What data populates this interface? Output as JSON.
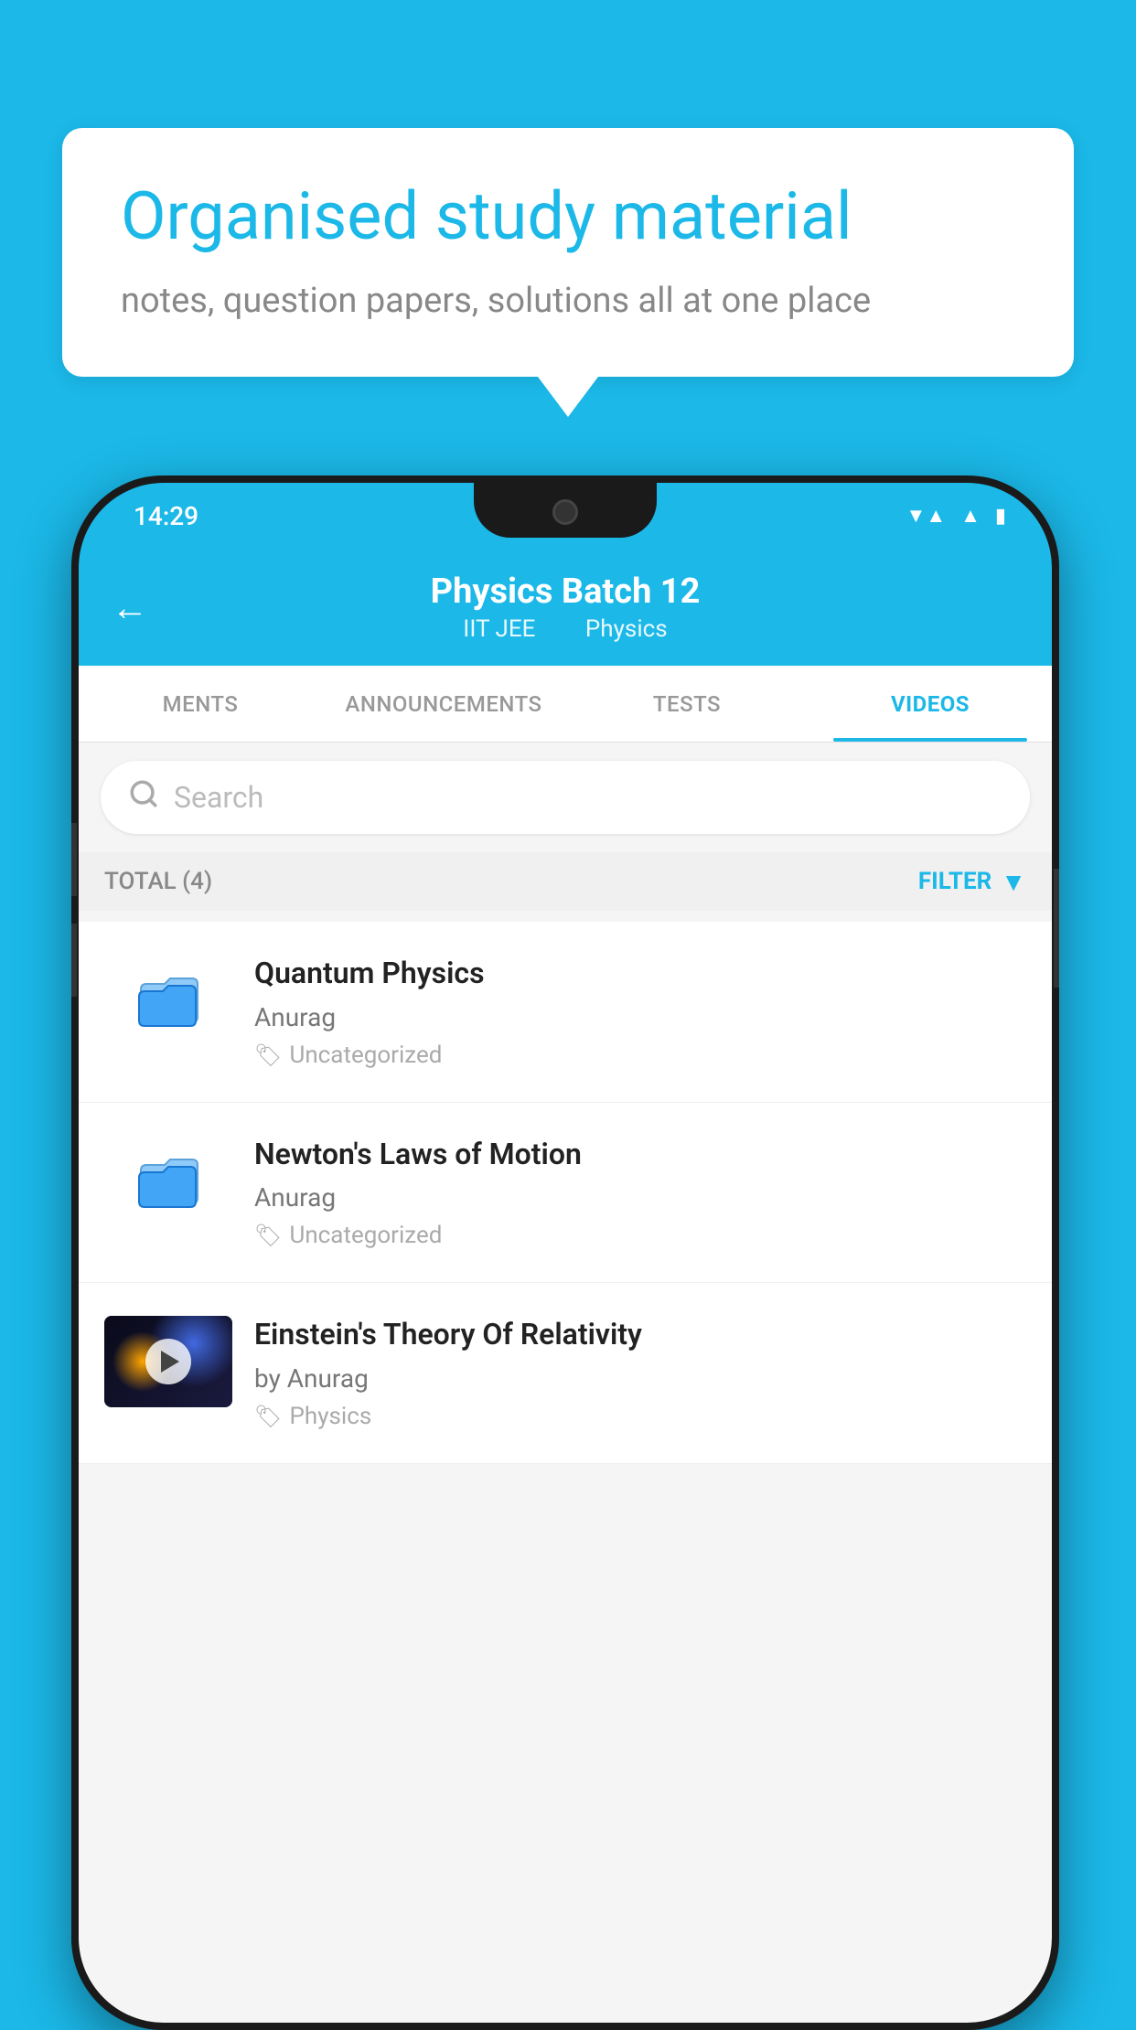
{
  "background_color": "#1bb8e8",
  "speech_bubble": {
    "title": "Organised study material",
    "subtitle": "notes, question papers, solutions all at one place"
  },
  "status_bar": {
    "time": "14:29",
    "wifi": "▼▲",
    "signal": "▲",
    "battery": "▮"
  },
  "header": {
    "back_label": "←",
    "title": "Physics Batch 12",
    "subtitle_part1": "IIT JEE",
    "subtitle_part2": "Physics"
  },
  "tabs": [
    {
      "label": "MENTS",
      "active": false
    },
    {
      "label": "ANNOUNCEMENTS",
      "active": false
    },
    {
      "label": "TESTS",
      "active": false
    },
    {
      "label": "VIDEOS",
      "active": true
    }
  ],
  "search": {
    "placeholder": "Search"
  },
  "filter_bar": {
    "total_label": "TOTAL (4)",
    "filter_label": "FILTER"
  },
  "videos": [
    {
      "title": "Quantum Physics",
      "author": "Anurag",
      "tag": "Uncategorized",
      "has_thumbnail": false
    },
    {
      "title": "Newton's Laws of Motion",
      "author": "Anurag",
      "tag": "Uncategorized",
      "has_thumbnail": false
    },
    {
      "title": "Einstein's Theory Of Relativity",
      "author": "by Anurag",
      "tag": "Physics",
      "has_thumbnail": true
    }
  ]
}
